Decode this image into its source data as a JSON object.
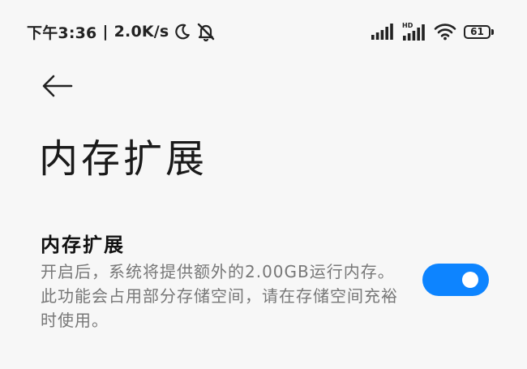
{
  "status_bar": {
    "time": "下午3:36",
    "separator": "|",
    "network_speed": "2.0K/s",
    "hd_label": "HD",
    "battery_level": "61",
    "icons": [
      "moon-icon",
      "bell-off-icon",
      "signal-icon",
      "hd-signal-icon",
      "wifi-icon",
      "battery-icon"
    ]
  },
  "header": {
    "back_icon": "arrow-left-icon",
    "title": "内存扩展"
  },
  "setting": {
    "title": "内存扩展",
    "description": "开启后，系统将提供额外的2.00GB运行内存。此功能会占用部分存储空间，请在存储空间充裕时使用。",
    "enabled": true
  },
  "colors": {
    "background": "#f7f7f7",
    "accent": "#0d84ff",
    "text_primary": "#111111",
    "text_secondary": "#777777"
  }
}
